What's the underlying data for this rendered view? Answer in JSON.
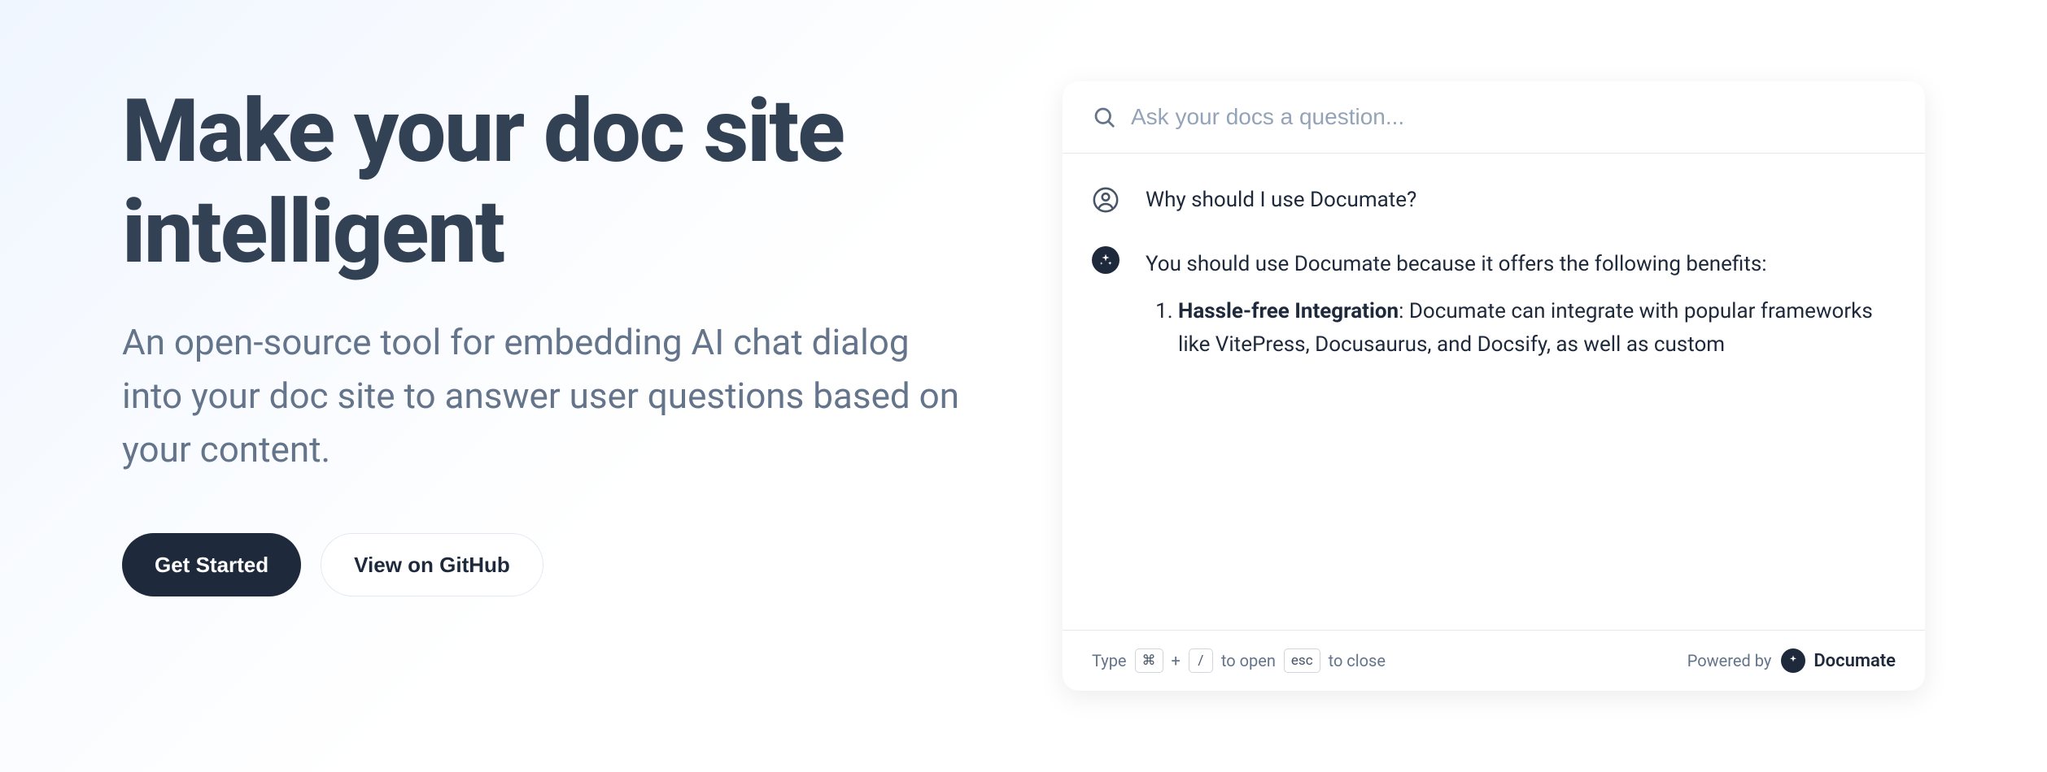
{
  "hero": {
    "title": "Make your doc site intelligent",
    "subtitle": "An open-source tool for embedding AI chat dialog into your doc site to answer user questions based on your content.",
    "get_started_label": "Get Started",
    "github_label": "View on GitHub"
  },
  "chat": {
    "search_placeholder": "Ask your docs a question...",
    "question": "Why should I use Documate?",
    "answer_intro": "You should use Documate because it offers the following benefits:",
    "answer_item_title": "Hassle-free Integration",
    "answer_item_body": ": Documate can integrate with popular frameworks like VitePress, Docusaurus, and Docsify, as well as custom"
  },
  "footer": {
    "type_label": "Type",
    "cmd_key": "⌘",
    "plus": "+",
    "slash_key": "/",
    "to_open": "to open",
    "esc_key": "esc",
    "to_close": "to close",
    "powered_by": "Powered by",
    "brand": "Documate"
  }
}
